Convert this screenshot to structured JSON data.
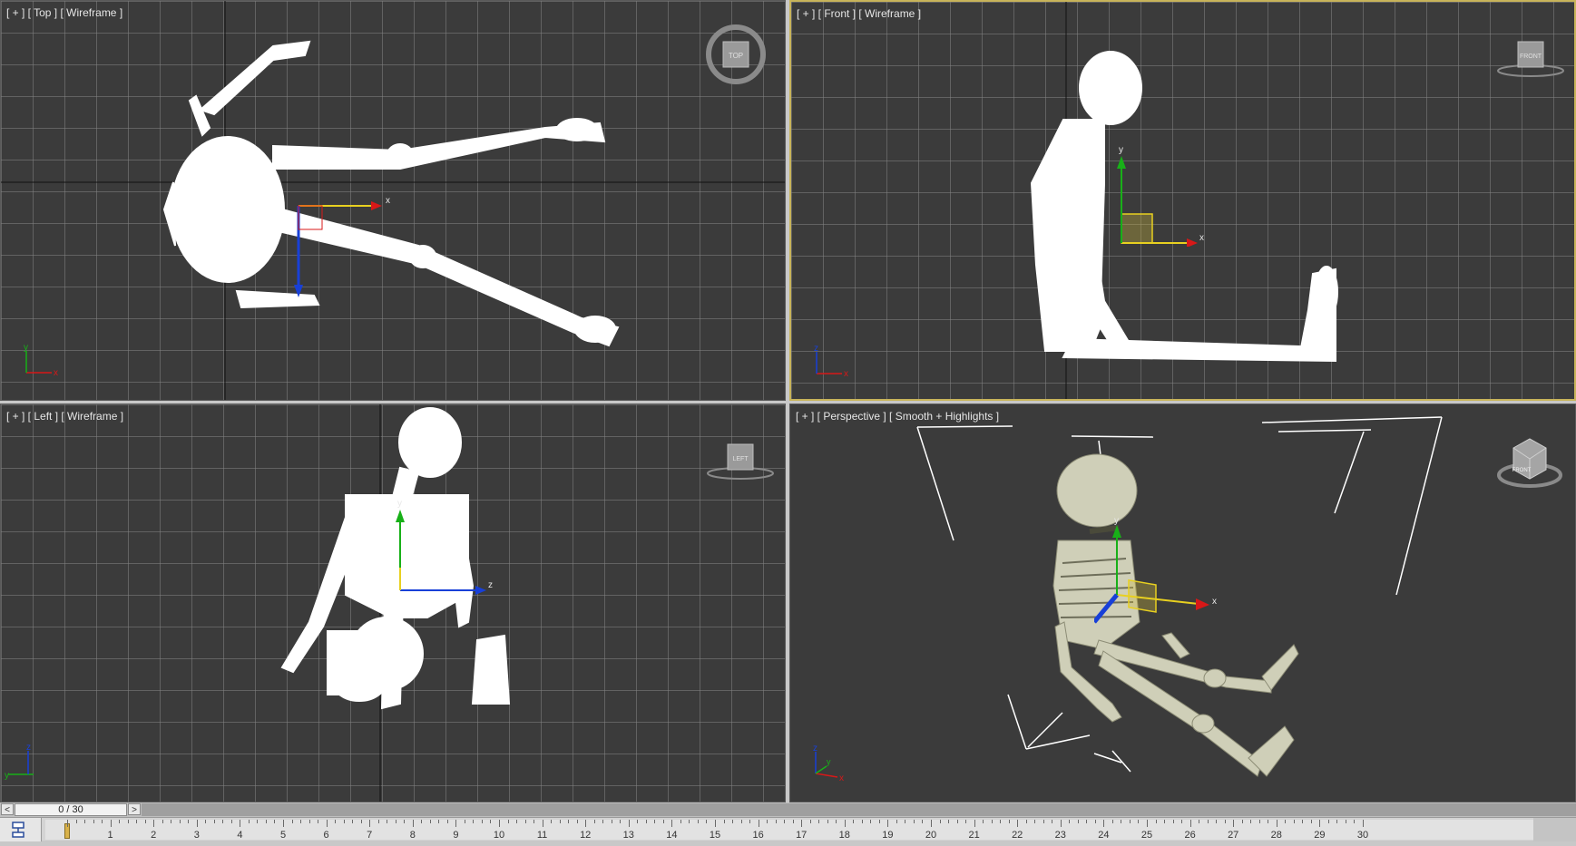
{
  "viewports": {
    "top": {
      "label": "[ + ] [ Top ] [ Wireframe ]",
      "viewcube": "TOP"
    },
    "front": {
      "label": "[ + ] [ Front ] [ Wireframe ]",
      "viewcube": "FRONT"
    },
    "left": {
      "label": "[ + ] [ Left ] [ Wireframe ]",
      "viewcube": "LEFT"
    },
    "persp": {
      "label": "[ + ] [ Perspective ] [ Smooth + Highlights ]",
      "viewcube": "FRONT"
    }
  },
  "axes": {
    "x": "x",
    "y": "y",
    "z": "z"
  },
  "timeline": {
    "prev": "<",
    "next": ">",
    "current_frame": "0 / 30",
    "frames": [
      "0",
      "1",
      "2",
      "3",
      "4",
      "5",
      "6",
      "7",
      "8",
      "9",
      "10",
      "11",
      "12",
      "13",
      "14",
      "15",
      "16",
      "17",
      "18",
      "19",
      "20",
      "21",
      "22",
      "23",
      "24",
      "25",
      "26",
      "27",
      "28",
      "29",
      "30"
    ]
  },
  "colors": {
    "viewport_bg": "#3b3b3b",
    "active_border": "#c8b45a",
    "axis_x": "#d81818",
    "axis_y": "#18b018",
    "axis_z": "#1840d8",
    "wire": "#ffffff",
    "bone": "#cfcfb8"
  }
}
